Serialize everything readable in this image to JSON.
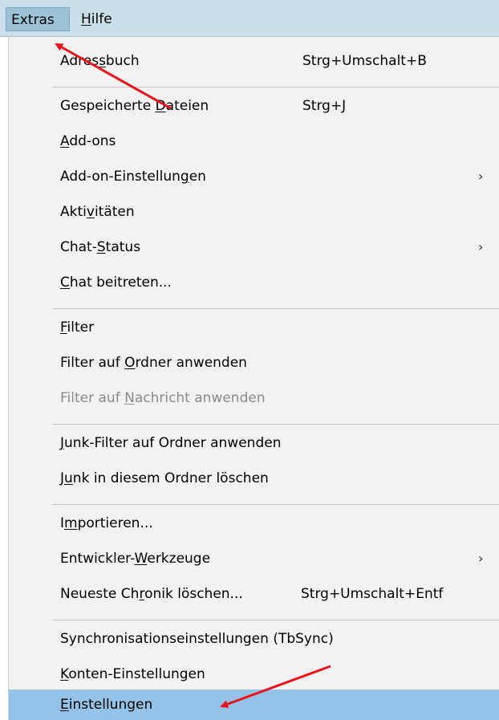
{
  "menubar": {
    "extras": "Extras",
    "hilfe_h": "H",
    "hilfe_rest": "ilfe"
  },
  "items": [
    {
      "pre": "Adres",
      "acc": "s",
      "post": "buch",
      "shortcut": "Strg+Umschalt+B"
    },
    {
      "pre": "Gespeicherte ",
      "acc": "D",
      "post": "ateien",
      "shortcut": "Strg+J"
    },
    {
      "pre": "",
      "acc": "A",
      "post": "dd-ons"
    },
    {
      "pre": "Add-on-Einstellun",
      "acc": "g",
      "post": "en",
      "submenu": "›"
    },
    {
      "pre": "Akti",
      "acc": "v",
      "post": "itäten"
    },
    {
      "pre": "Chat-",
      "acc": "S",
      "post": "tatus",
      "submenu": "›"
    },
    {
      "pre": "",
      "acc": "C",
      "post": "hat beitreten..."
    },
    {
      "pre": "",
      "acc": "F",
      "post": "ilter"
    },
    {
      "pre": "Filter auf ",
      "acc": "O",
      "post": "rdner anwenden"
    },
    {
      "pre": "Filter auf ",
      "acc": "N",
      "post": "achricht anwenden"
    },
    {
      "pre": "",
      "acc": "J",
      "post": "unk-Filter auf Ordner anwenden"
    },
    {
      "pre": "J",
      "acc": "u",
      "post": "nk in diesem Ordner löschen"
    },
    {
      "pre": "I",
      "acc": "m",
      "post": "portieren..."
    },
    {
      "pre": "Entwickler-",
      "acc": "W",
      "post": "erkzeuge",
      "submenu": "›"
    },
    {
      "pre": "Neueste Ch",
      "acc": "r",
      "post": "onik löschen...",
      "shortcut": "Strg+Umschalt+Entf"
    },
    {
      "pre": "Synchronisationseinstellungen (TbSync)",
      "acc": "",
      "post": ""
    },
    {
      "pre": "",
      "acc": "K",
      "post": "onten-Einstellungen"
    },
    {
      "pre": "",
      "acc": "E",
      "post": "instellungen"
    }
  ],
  "colors": {
    "menubar_bg": "#c9dfe9",
    "menu_bg": "#f2f2f2",
    "highlight": "#95c3e7",
    "arrow": "#e8131b",
    "disabled_text": "#8a8a8a"
  }
}
